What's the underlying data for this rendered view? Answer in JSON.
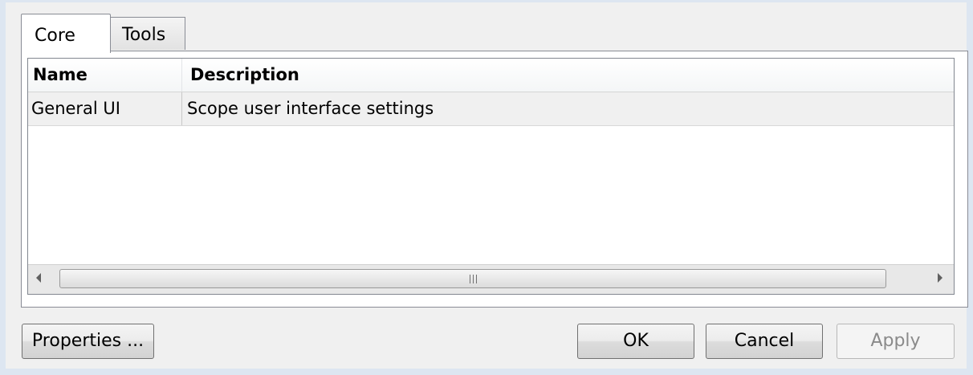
{
  "tabs": [
    {
      "label": "Core",
      "selected": true
    },
    {
      "label": "Tools",
      "selected": false
    }
  ],
  "table": {
    "columns": [
      "Name",
      "Description"
    ],
    "rows": [
      {
        "name": "General UI",
        "description": "Scope user interface settings"
      }
    ]
  },
  "buttons": {
    "properties": "Properties ...",
    "ok": "OK",
    "cancel": "Cancel",
    "apply": "Apply"
  }
}
